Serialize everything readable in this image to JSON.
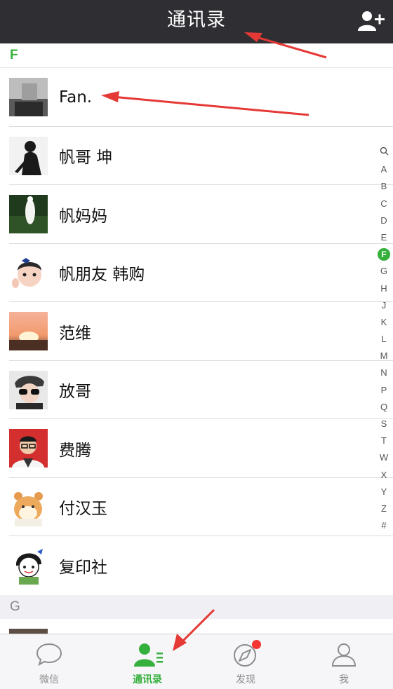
{
  "nav": {
    "title": "通讯录",
    "add_icon": "add-contact-icon"
  },
  "sections": [
    {
      "letter": "F",
      "contacts": [
        "Fan.",
        "帆哥 坤",
        "帆妈妈",
        "帆朋友 韩购",
        "范维",
        "放哥",
        "费腾",
        "付汉玉",
        "复印社"
      ]
    },
    {
      "letter": "G",
      "contacts": []
    }
  ],
  "index": [
    "search",
    "A",
    "B",
    "C",
    "D",
    "E",
    "F",
    "G",
    "H",
    "J",
    "K",
    "L",
    "M",
    "N",
    "P",
    "Q",
    "S",
    "T",
    "W",
    "X",
    "Y",
    "Z",
    "#"
  ],
  "index_active": "F",
  "tabs": [
    {
      "label": "微信",
      "icon": "chat-bubble-icon",
      "active": false,
      "badge": false
    },
    {
      "label": "通讯录",
      "icon": "contacts-icon",
      "active": true,
      "badge": false
    },
    {
      "label": "发现",
      "icon": "compass-icon",
      "active": false,
      "badge": true
    },
    {
      "label": "我",
      "icon": "person-icon",
      "active": false,
      "badge": false
    }
  ],
  "colors": {
    "accent": "#35b03d",
    "nav_bg": "#2e2e33",
    "badge": "#f43530",
    "arrow": "#e53935"
  }
}
